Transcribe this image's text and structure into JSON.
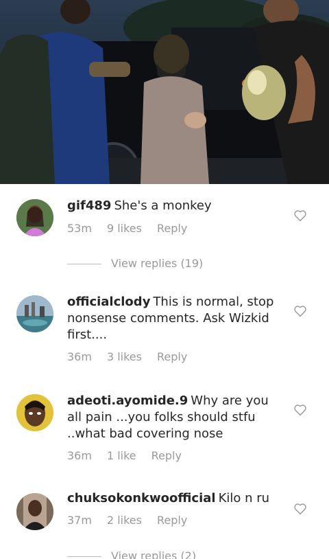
{
  "comments": [
    {
      "username": "gif489",
      "text": "She's a monkey",
      "time": "53m",
      "likes": "9 likes",
      "reply_label": "Reply"
    },
    {
      "username": "officialclody",
      "text": "This is normal, stop nonsense comments. Ask Wizkid first....",
      "time": "36m",
      "likes": "3 likes",
      "reply_label": "Reply"
    },
    {
      "username": "adeoti.ayomide.9",
      "text": "Why are you all pain ...you folks should stfu ..what bad covering nose",
      "time": "36m",
      "likes": "1 like",
      "reply_label": "Reply"
    },
    {
      "username": "chuksokonkwoofficial",
      "text": "Kilo n ru",
      "time": "37m",
      "likes": "2 likes",
      "reply_label": "Reply"
    }
  ],
  "view_replies": [
    {
      "label": "View replies (19)"
    },
    {
      "label": "View replies (2)"
    }
  ],
  "colors": {
    "text": "#262626",
    "meta": "#999999"
  },
  "icons": {
    "like": "heart-outline-icon"
  }
}
